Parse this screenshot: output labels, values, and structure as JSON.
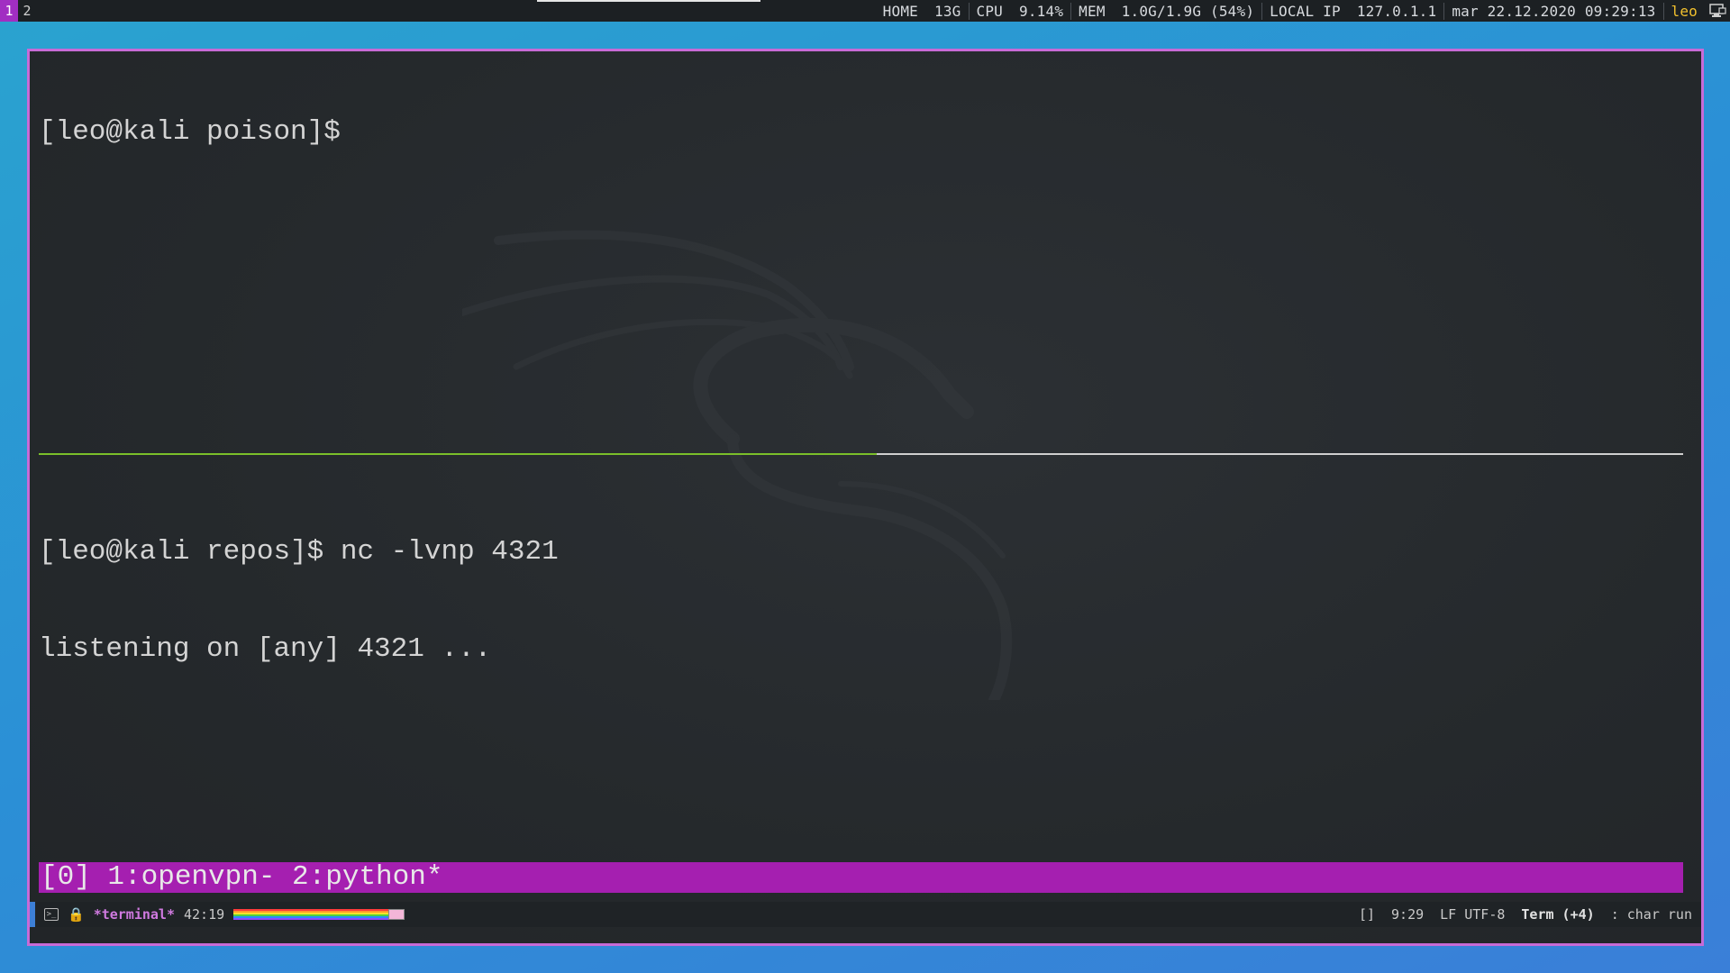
{
  "topbar": {
    "workspaces": [
      "1",
      "2"
    ],
    "active_workspace": "1",
    "home_label": "HOME",
    "home_value": "13G",
    "cpu_label": "CPU",
    "cpu_value": "9.14%",
    "mem_label": "MEM",
    "mem_value": "1.0G/1.9G (54%)",
    "ip_label": "LOCAL IP",
    "ip_value": "127.0.1.1",
    "datetime": "mar 22.12.2020 09:29:13",
    "user": "leo",
    "tray_icon": "network-icon"
  },
  "terminal": {
    "top_pane_line": "[leo@kali poison]$",
    "bottom_pane_lines": [
      "[leo@kali repos]$ nc -lvnp 4321",
      "listening on [any] 4321 ..."
    ],
    "tmux_status": "[0] 1:openvpn- 2:python*"
  },
  "modeline": {
    "buffer_name": "*terminal*",
    "position": "42:19",
    "right_brackets": "[]",
    "time": "9:29",
    "encoding": "LF UTF-8",
    "major_mode": "Term (+4)",
    "minor_mode": ": char run"
  },
  "colors": {
    "accent_purple": "#a51fb0",
    "window_border": "#c86bd6",
    "active_divider": "#7bbf2a",
    "user_highlight": "#f2c12e"
  }
}
